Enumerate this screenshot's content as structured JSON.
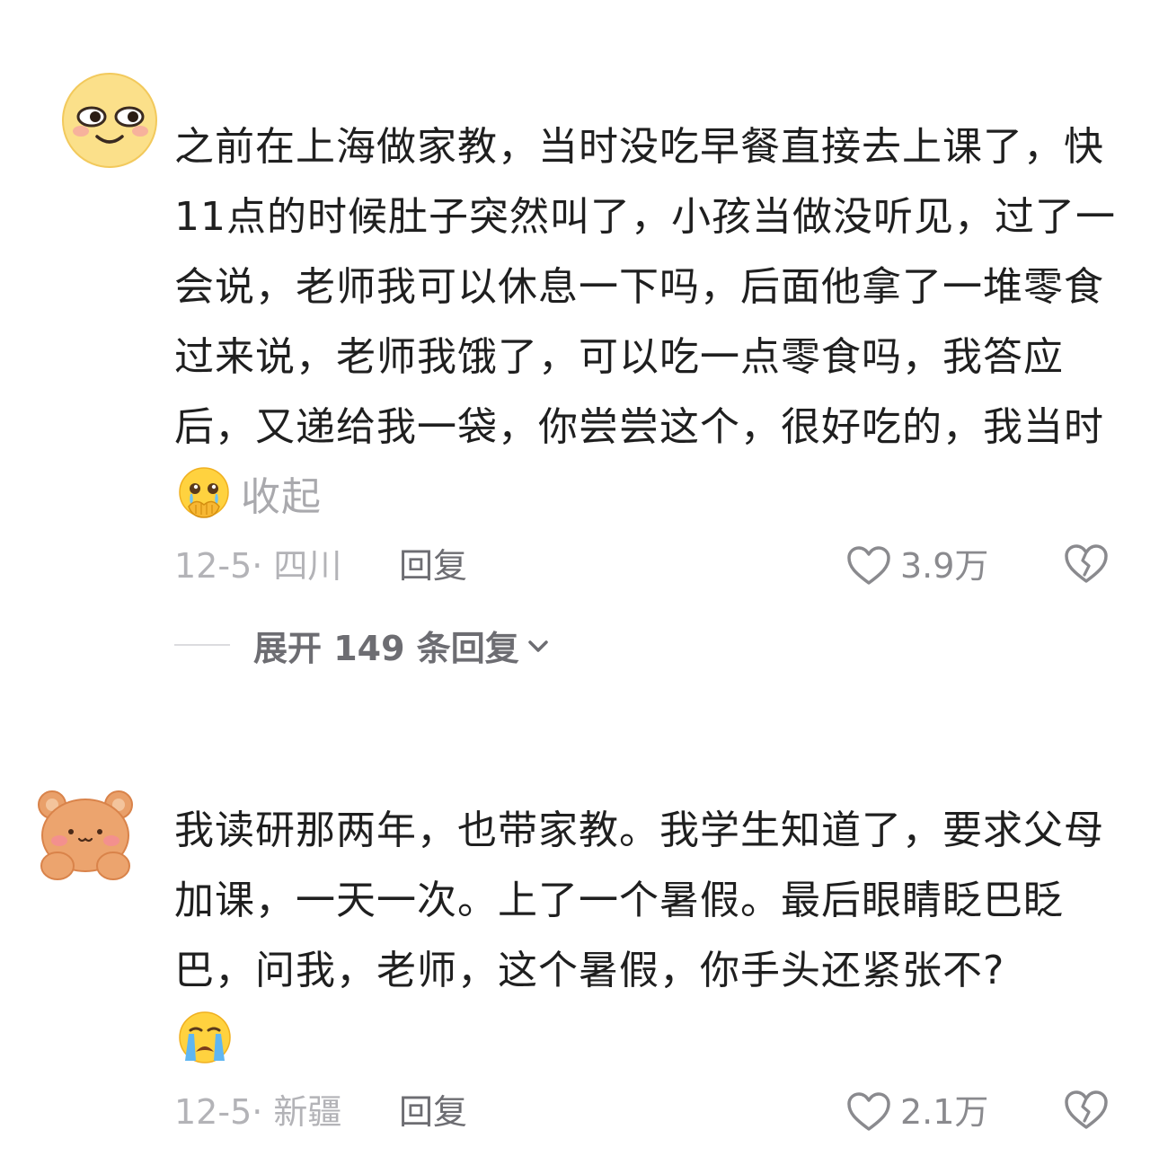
{
  "comments": [
    {
      "avatar_icon": "smiling-face-avatar",
      "text_before_emoji": "之前在上海做家教，当时没吃早餐直接去上课了，快11点的时候肚子突然叫了，小孩当做没听见，过了一会说，老师我可以休息一下吗，后面他拿了一堆零食过来说，老师我饿了，可以吃一点零食吗，我答应后，又递给我一袋，你尝尝这个，很好吃的，我当时",
      "inline_emoji": "holding-back-tears-emoji",
      "collapse_label": "收起",
      "date_location": "12-5· 四川",
      "reply_label": "回复",
      "like_count": "3.9万",
      "expand_replies_label": "展开 149 条回复"
    },
    {
      "avatar_icon": "bear-avatar",
      "text": "我读研那两年，也带家教。我学生知道了，要求父母加课，一天一次。上了一个暑假。最后眼睛眨巴眨巴，问我，老师，这个暑假，你手头还紧张不?",
      "trailing_emoji": "crying-face-emoji",
      "date_location": "12-5· 新疆",
      "reply_label": "回复",
      "like_count": "2.1万"
    }
  ],
  "colors": {
    "text": "#1f1f1f",
    "muted": "#b3b3b7",
    "secondary": "#6d6d72",
    "collapse": "#a9a9ad"
  }
}
